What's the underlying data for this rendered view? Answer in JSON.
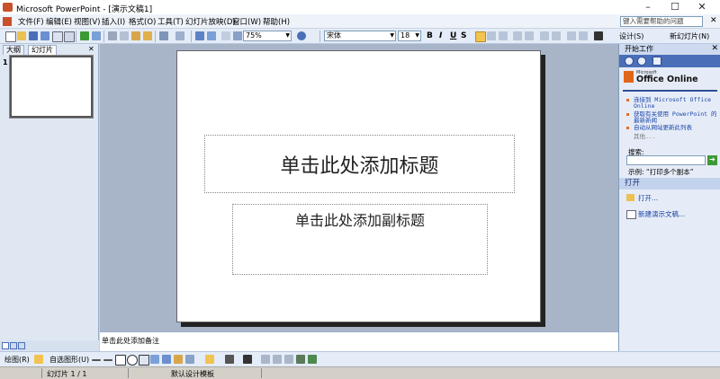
{
  "window": {
    "title": "Microsoft PowerPoint - [演示文稿1]",
    "controls": [
      "–",
      "☐",
      "✕"
    ]
  },
  "menu": {
    "items": [
      "文件(F)",
      "编辑(E)",
      "视图(V)",
      "插入(I)",
      "格式(O)",
      "工具(T)",
      "幻灯片放映(D)",
      "窗口(W)",
      "帮助(H)"
    ],
    "help_placeholder": "键入需要帮助的问题",
    "close": "✕"
  },
  "toolbar": {
    "zoom": "75%",
    "font_name": "宋体",
    "font_size": "18",
    "bold": "B",
    "italic": "I",
    "underline": "U",
    "shadow": "S",
    "design_label": "设计(S)",
    "new_slide_label": "新幻灯片(N)"
  },
  "left_pane": {
    "tabs": [
      "大纲",
      "幻灯片"
    ],
    "close": "✕",
    "slide_number": "1"
  },
  "slide": {
    "title_placeholder": "单击此处添加标题",
    "subtitle_placeholder": "单击此处添加副标题"
  },
  "notes": {
    "placeholder": "单击此处添加备注"
  },
  "task_pane": {
    "header": "开始工作",
    "close": "✕",
    "logo_small": "Microsoft",
    "logo_text": "Office Online",
    "links": [
      "连接到 Microsoft Office Online",
      "获取有关使用 PowerPoint 的最新新闻",
      "自动从网站更新此列表"
    ],
    "more": "其他...",
    "search_label": "搜索:",
    "go": "➔",
    "example": "示例: “打印多个副本”",
    "open_header": "打开",
    "open_item": "打开...",
    "new_item": "新建演示文稿..."
  },
  "drawing_toolbar": {
    "draw_label": "绘图(R)",
    "autoshape_label": "自选图形(U)"
  },
  "status": {
    "slide_pos": "幻灯片 1 / 1",
    "design": "默认设计模板"
  }
}
